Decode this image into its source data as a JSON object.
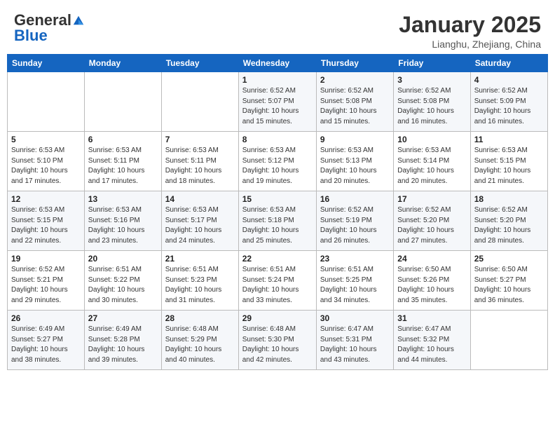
{
  "header": {
    "logo_general": "General",
    "logo_blue": "Blue",
    "month": "January 2025",
    "location": "Lianghu, Zhejiang, China"
  },
  "days_of_week": [
    "Sunday",
    "Monday",
    "Tuesday",
    "Wednesday",
    "Thursday",
    "Friday",
    "Saturday"
  ],
  "weeks": [
    [
      {
        "day": "",
        "info": ""
      },
      {
        "day": "",
        "info": ""
      },
      {
        "day": "",
        "info": ""
      },
      {
        "day": "1",
        "info": "Sunrise: 6:52 AM\nSunset: 5:07 PM\nDaylight: 10 hours\nand 15 minutes."
      },
      {
        "day": "2",
        "info": "Sunrise: 6:52 AM\nSunset: 5:08 PM\nDaylight: 10 hours\nand 15 minutes."
      },
      {
        "day": "3",
        "info": "Sunrise: 6:52 AM\nSunset: 5:08 PM\nDaylight: 10 hours\nand 16 minutes."
      },
      {
        "day": "4",
        "info": "Sunrise: 6:52 AM\nSunset: 5:09 PM\nDaylight: 10 hours\nand 16 minutes."
      }
    ],
    [
      {
        "day": "5",
        "info": "Sunrise: 6:53 AM\nSunset: 5:10 PM\nDaylight: 10 hours\nand 17 minutes."
      },
      {
        "day": "6",
        "info": "Sunrise: 6:53 AM\nSunset: 5:11 PM\nDaylight: 10 hours\nand 17 minutes."
      },
      {
        "day": "7",
        "info": "Sunrise: 6:53 AM\nSunset: 5:11 PM\nDaylight: 10 hours\nand 18 minutes."
      },
      {
        "day": "8",
        "info": "Sunrise: 6:53 AM\nSunset: 5:12 PM\nDaylight: 10 hours\nand 19 minutes."
      },
      {
        "day": "9",
        "info": "Sunrise: 6:53 AM\nSunset: 5:13 PM\nDaylight: 10 hours\nand 20 minutes."
      },
      {
        "day": "10",
        "info": "Sunrise: 6:53 AM\nSunset: 5:14 PM\nDaylight: 10 hours\nand 20 minutes."
      },
      {
        "day": "11",
        "info": "Sunrise: 6:53 AM\nSunset: 5:15 PM\nDaylight: 10 hours\nand 21 minutes."
      }
    ],
    [
      {
        "day": "12",
        "info": "Sunrise: 6:53 AM\nSunset: 5:15 PM\nDaylight: 10 hours\nand 22 minutes."
      },
      {
        "day": "13",
        "info": "Sunrise: 6:53 AM\nSunset: 5:16 PM\nDaylight: 10 hours\nand 23 minutes."
      },
      {
        "day": "14",
        "info": "Sunrise: 6:53 AM\nSunset: 5:17 PM\nDaylight: 10 hours\nand 24 minutes."
      },
      {
        "day": "15",
        "info": "Sunrise: 6:53 AM\nSunset: 5:18 PM\nDaylight: 10 hours\nand 25 minutes."
      },
      {
        "day": "16",
        "info": "Sunrise: 6:52 AM\nSunset: 5:19 PM\nDaylight: 10 hours\nand 26 minutes."
      },
      {
        "day": "17",
        "info": "Sunrise: 6:52 AM\nSunset: 5:20 PM\nDaylight: 10 hours\nand 27 minutes."
      },
      {
        "day": "18",
        "info": "Sunrise: 6:52 AM\nSunset: 5:20 PM\nDaylight: 10 hours\nand 28 minutes."
      }
    ],
    [
      {
        "day": "19",
        "info": "Sunrise: 6:52 AM\nSunset: 5:21 PM\nDaylight: 10 hours\nand 29 minutes."
      },
      {
        "day": "20",
        "info": "Sunrise: 6:51 AM\nSunset: 5:22 PM\nDaylight: 10 hours\nand 30 minutes."
      },
      {
        "day": "21",
        "info": "Sunrise: 6:51 AM\nSunset: 5:23 PM\nDaylight: 10 hours\nand 31 minutes."
      },
      {
        "day": "22",
        "info": "Sunrise: 6:51 AM\nSunset: 5:24 PM\nDaylight: 10 hours\nand 33 minutes."
      },
      {
        "day": "23",
        "info": "Sunrise: 6:51 AM\nSunset: 5:25 PM\nDaylight: 10 hours\nand 34 minutes."
      },
      {
        "day": "24",
        "info": "Sunrise: 6:50 AM\nSunset: 5:26 PM\nDaylight: 10 hours\nand 35 minutes."
      },
      {
        "day": "25",
        "info": "Sunrise: 6:50 AM\nSunset: 5:27 PM\nDaylight: 10 hours\nand 36 minutes."
      }
    ],
    [
      {
        "day": "26",
        "info": "Sunrise: 6:49 AM\nSunset: 5:27 PM\nDaylight: 10 hours\nand 38 minutes."
      },
      {
        "day": "27",
        "info": "Sunrise: 6:49 AM\nSunset: 5:28 PM\nDaylight: 10 hours\nand 39 minutes."
      },
      {
        "day": "28",
        "info": "Sunrise: 6:48 AM\nSunset: 5:29 PM\nDaylight: 10 hours\nand 40 minutes."
      },
      {
        "day": "29",
        "info": "Sunrise: 6:48 AM\nSunset: 5:30 PM\nDaylight: 10 hours\nand 42 minutes."
      },
      {
        "day": "30",
        "info": "Sunrise: 6:47 AM\nSunset: 5:31 PM\nDaylight: 10 hours\nand 43 minutes."
      },
      {
        "day": "31",
        "info": "Sunrise: 6:47 AM\nSunset: 5:32 PM\nDaylight: 10 hours\nand 44 minutes."
      },
      {
        "day": "",
        "info": ""
      }
    ]
  ]
}
